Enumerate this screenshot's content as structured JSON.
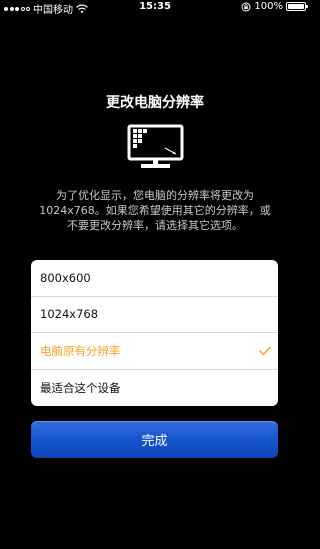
{
  "status_bar": {
    "carrier": "中国移动",
    "time": "15:35",
    "battery_text": "100%",
    "battery_level": 1.0
  },
  "header": {
    "title": "更改电脑分辨率",
    "icon": "monitor-resolution-icon"
  },
  "description": {
    "line1": "为了优化显示，您电脑的分辨率将更改为",
    "line2": "1024x768。如果您希望使用其它的分辨率，或",
    "line3": "不要更改分辨率，请选择其它选项。"
  },
  "options": [
    {
      "label": "800x600",
      "selected": false
    },
    {
      "label": "1024x768",
      "selected": false
    },
    {
      "label": "电脑原有分辨率",
      "selected": true
    },
    {
      "label": "最适合这个设备",
      "selected": false
    }
  ],
  "done_button": {
    "label": "完成"
  },
  "colors": {
    "background": "#000000",
    "accent_selected": "#f5a623",
    "button_blue": "#1553cc"
  }
}
